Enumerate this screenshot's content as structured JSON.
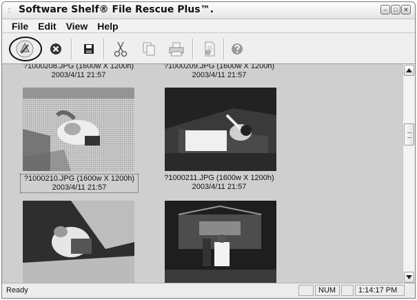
{
  "window": {
    "title": "Software Shelf® File Rescue Plus™.",
    "controls": {
      "minimize": "–",
      "restore": "□",
      "close": "✕"
    }
  },
  "menu": [
    "File",
    "Edit",
    "View",
    "Help"
  ],
  "toolbar": [
    {
      "name": "recover-icon"
    },
    {
      "name": "stop-icon"
    },
    {
      "name": "save-icon"
    },
    {
      "name": "cut-icon"
    },
    {
      "name": "copy-icon"
    },
    {
      "name": "print-icon"
    },
    {
      "name": "document-icon"
    },
    {
      "name": "help-icon"
    }
  ],
  "thumbnails": [
    {
      "filename": "?1000208.JPG  (1600w X 1200h)",
      "date": "2003/4/11 21:57"
    },
    {
      "filename": "?1000209.JPG  (1600w X 1200h)",
      "date": "2003/4/11 21:57"
    },
    {
      "filename": "?1000210.JPG  (1600w X 1200h)",
      "date": "2003/4/11 21:57"
    },
    {
      "filename": "?1000211.JPG  (1600w X 1200h)",
      "date": "2003/4/11 21:57"
    }
  ],
  "status": {
    "text": "Ready",
    "num_indicator": "NUM",
    "time": "1:14:17 PM"
  }
}
